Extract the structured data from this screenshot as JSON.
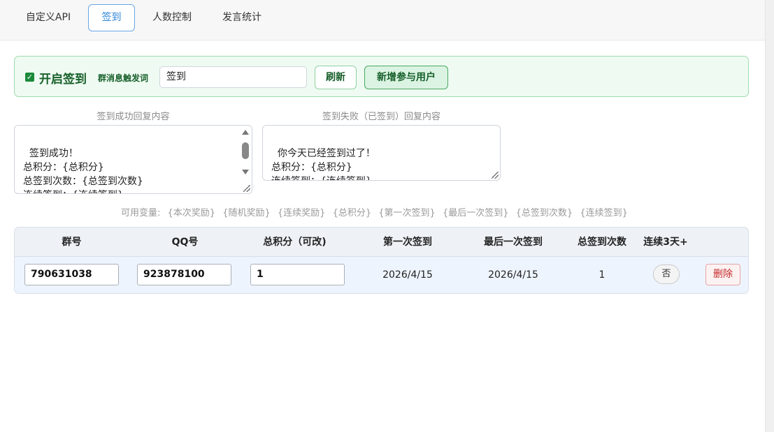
{
  "tabs": [
    {
      "label": "自定义API",
      "active": false
    },
    {
      "label": "签到",
      "active": true
    },
    {
      "label": "人数控制",
      "active": false
    },
    {
      "label": "发言统计",
      "active": false
    }
  ],
  "signin": {
    "enabled": true,
    "enable_label": "开启签到",
    "trigger_label": "群消息触发词",
    "trigger_value": "签到",
    "refresh_label": "刷新",
    "add_user_label": "新增参与用户"
  },
  "replies": {
    "success_caption": "签到成功回复内容",
    "success_text": "签到成功！\n总积分：{总积分}\n总签到次数：{总签到次数}\n连续签到：{连续签到}\n第一次签到：{第一次签到}",
    "fail_caption": "签到失败（已签到）回复内容",
    "fail_text": "你今天已经签到过了！\n总积分：{总积分}\n连续签到：{连续签到}"
  },
  "variables": {
    "label": "可用变量:",
    "items": [
      "{本次奖励}",
      "{随机奖励}",
      "{连续奖励}",
      "{总积分}",
      "{第一次签到}",
      "{最后一次签到}",
      "{总签到次数}",
      "{连续签到}"
    ]
  },
  "table": {
    "headers": [
      "群号",
      "QQ号",
      "总积分（可改)",
      "第一次签到",
      "最后一次签到",
      "总签到次数",
      "连续3天+"
    ],
    "rows": [
      {
        "group": "790631038",
        "qq": "923878100",
        "points": "1",
        "first_signin": "2026/4/15 16:02:44",
        "last_signin": "2026/4/15 16:02:44",
        "total_count": "1",
        "streak3": "否",
        "delete_label": "删除"
      }
    ]
  },
  "colors": {
    "accent_blue": "#2f86d8",
    "panel_green": "#effbf2",
    "text_green": "#175f2a",
    "danger_red": "#c42a2a"
  }
}
